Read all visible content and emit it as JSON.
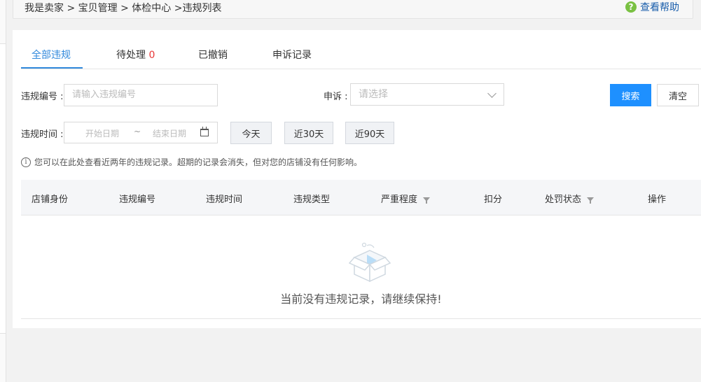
{
  "breadcrumb": "我是卖家 > 宝贝管理 > 体检中心 >违规列表",
  "help": {
    "icon": "help-question-icon",
    "label": "查看帮助",
    "icon_color": "#7ac143",
    "text_color": "#1a5eab"
  },
  "tabs": [
    {
      "label": "全部违规",
      "active": true
    },
    {
      "label": "待处理",
      "count": "0"
    },
    {
      "label": "已撤销"
    },
    {
      "label": "申诉记录"
    }
  ],
  "filters": {
    "violation_no_label": "违规编号",
    "violation_no_placeholder": "请输入违规编号",
    "appeal_label": "申诉",
    "appeal_placeholder": "请选择",
    "time_label": "违规时间",
    "start_placeholder": "开始日期",
    "range_sep": "~",
    "end_placeholder": "结束日期",
    "quick": [
      "今天",
      "近30天",
      "近90天"
    ],
    "search_label": "搜索",
    "clear_label": "清空"
  },
  "notice": "您可以在此处查看近两年的违规记录。超期的记录会消失，但对您的店铺没有任何影响。",
  "table": {
    "columns": [
      "店铺身份",
      "违规编号",
      "违规时间",
      "违规类型",
      "严重程度",
      "扣分",
      "处罚状态",
      "操作"
    ],
    "empty_text": "当前没有违规记录，请继续保持!"
  },
  "colors": {
    "accent": "#3089dc",
    "primary_button": "#1e90ff",
    "count_red": "#e83838"
  }
}
